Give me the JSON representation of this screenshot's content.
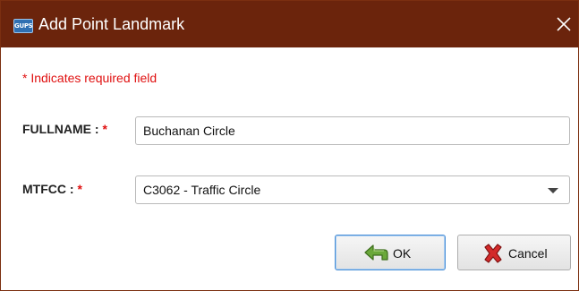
{
  "window": {
    "app_icon_text": "GUPS",
    "title": "Add Point Landmark"
  },
  "form": {
    "required_note": "* Indicates required field",
    "fullname_label": "FULLNAME :",
    "fullname_value": "Buchanan Circle",
    "mtfcc_label": "MTFCC :",
    "mtfcc_value": "C3062 - Traffic Circle",
    "required_marker": "*"
  },
  "buttons": {
    "ok_label": "OK",
    "cancel_label": "Cancel"
  },
  "icons": {
    "app": "app-logo-icon",
    "close": "close-icon",
    "dropdown": "chevron-down-icon",
    "ok": "green-arrow-icon",
    "cancel": "red-x-icon"
  },
  "colors": {
    "titlebar": "#6b240c",
    "required": "#e01010",
    "ok_border": "#4a8fd6"
  }
}
